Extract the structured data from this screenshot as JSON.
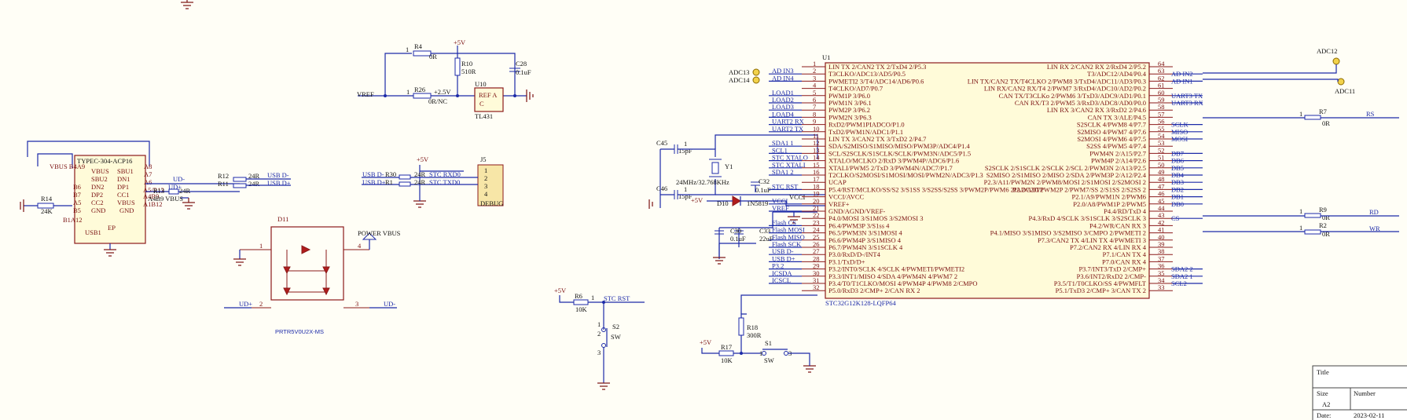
{
  "top_ref": {
    "r4": "R4",
    "r4_val": "0R",
    "r4_pin": "1",
    "vcc": "+5V",
    "r10": "R10",
    "r10_val": "510R",
    "c28": "C28",
    "c28_val": "0.1uF",
    "u10": "U10",
    "u10_ref": "REF A",
    "u10_c": "C",
    "u10_part": "TL431",
    "vref": "VREF",
    "r26": "R26",
    "r26_val": "0R/NC",
    "r26_pin": "1",
    "r26_net": "+2.5V"
  },
  "usb": {
    "part": "TYPEC-304-ACP16",
    "vbus_b4a9": "VBUS B4A9",
    "left_pins": [
      "B6",
      "B7",
      "A5",
      "B5",
      "B1A12"
    ],
    "left_names": [
      "DN2",
      "DP2",
      "CC2",
      "GND"
    ],
    "right_names": [
      "SBU1",
      "DN1",
      "DP1",
      "CC1",
      "VBUS",
      "GND"
    ],
    "right_pins": [
      "A8",
      "A7",
      "A6",
      "A4B9",
      "A1B12"
    ],
    "vbus_left": "VBUS",
    "sbu2": "SBU2",
    "usb1": "USB1",
    "ep": "EP",
    "r14": "R14",
    "r14_val": "24K",
    "r13": "R13",
    "r13_val": "24R",
    "a5r13": "A5/R13",
    "udm": "UD-",
    "udp": "UD+",
    "r12": "R12",
    "r12_val": "24R",
    "r11": "R11",
    "r11_val": "24R",
    "usbdm": "USB D-",
    "usbdp": "USB D+",
    "a4b9_vbus": "A4B9 VBUS"
  },
  "debug": {
    "vcc": "+5V",
    "j5": "J5",
    "net_dm": "USB D-",
    "net_dp": "USB D+",
    "r30": "R30",
    "r30_val": "24R",
    "r1": "R1",
    "r1_val": "24R",
    "stc_rxd": "STC RXD0",
    "stc_txd": "STC TXD0",
    "pins": [
      "1",
      "2",
      "3",
      "4"
    ],
    "label": "DEBUG"
  },
  "prt": {
    "d11": "D11",
    "power_vbus": "POWER VBUS",
    "pin1": "1",
    "pin2": "2",
    "pin3": "3",
    "pin4": "4",
    "udp": "UD+",
    "udm": "UD-",
    "part": "PRTR5V0U2X-MS"
  },
  "reset": {
    "vcc": "+5V",
    "r6": "R6",
    "r6_val": "10K",
    "r6_pin": "1",
    "net": "STC RST",
    "s2": "S2",
    "sw": "SW",
    "p1": "1",
    "p2": "2",
    "p3": "3"
  },
  "sw1": {
    "vcc": "+5V",
    "r17": "R17",
    "r17_val": "10K",
    "r18": "R18",
    "r18_val": "300R",
    "s1": "S1",
    "sw": "SW",
    "p1": "1",
    "p3": "3"
  },
  "osc": {
    "c45": "C45",
    "c45_val": "15pF",
    "c46": "C46",
    "c46_val": "15pF",
    "y1": "Y1",
    "y1_val": "24MHz/32.768KHz",
    "c32": "C32",
    "c32_val": "0.1uF",
    "d10": "D10",
    "d10_val": "1N5819",
    "vcc": "+5V",
    "vcci": "VCCI",
    "c30": "C30",
    "c30_val": "0.1uF",
    "c33": "C33",
    "c33_val": "22uF",
    "one": "1",
    "one_b": "1"
  },
  "mcu": {
    "ref": "U1",
    "part": "STC32G12K128-LQFP64",
    "left_nets": [
      "",
      "AD IN3",
      "AD IN4",
      "",
      "LOAD1",
      "LOAD2",
      "LOAD3",
      "LOAD4",
      "UART2 RX",
      "UART2 TX",
      "",
      "SDA1 1",
      "SCL1",
      "STC XTALO",
      "STC XTALI",
      "SDA1 2",
      "",
      "STC RST",
      "",
      "VCCI",
      "VREF",
      "",
      "Flash CS",
      "Flash MOSI",
      "Flash MISO",
      "Flash SCK",
      "USB D-",
      "USB D+",
      "P3.2",
      "ICSDA",
      "ICSCL",
      ""
    ],
    "left_nums": [
      "1",
      "2",
      "3",
      "4",
      "5",
      "6",
      "7",
      "8",
      "9",
      "10",
      "11",
      "12",
      "13",
      "14",
      "15",
      "16",
      "17",
      "18",
      "19",
      "20",
      "21",
      "22",
      "23",
      "24",
      "25",
      "26",
      "27",
      "28",
      "29",
      "30",
      "31",
      "32"
    ],
    "left_names": [
      "LIN TX 2/CAN2 TX 2/TxD4 2/P5.3",
      "T3CLKO/ADC13/AD5/P0.5",
      "PWMETI2 3/T4/ADC14/AD6/P0.6",
      "T4CLKO/AD7/P0.7",
      "PWM1P 3/P6.0",
      "PWM1N 3/P6.1",
      "PWM2P 3/P6.2",
      "PWM2N 3/P6.3",
      "RxD2/PWM1PIADCO/P1.0",
      "TxD2/PWM1N/ADC1/P1.1",
      "LIN TX 3/CAN2 TX 3/TxD2 2/P4.7",
      "SDA/S2MISO/S1MISO/MISO/PWM3P/ADC4/P1.4",
      "SCL/S2SCLK/S1SCLK/SCLK/PWM3N/ADC5/P1.5",
      "XTALO/MCLKO 2/RxD 3/PWM4P/ADC6/P1.6",
      "XTALI/PWM5 2/TxD 3/PWM4N/ADC7/P1.7",
      "T2CLKO/S2MOSI/S1MOSI/MOSI/PWM2N/ADC3/P1.3",
      "UCAP",
      "P5.4/RST/MCLKO/SS/S2 3/S1SS 3/S2SS/S2SS 3/PWM2P/PWM6 2IADC2IT2",
      "VCCI/AVCC",
      "VREF+",
      "GND/AGND/VREF-",
      "P4.0/MOSI 3/S1MOS 3/S2MOSI 3",
      "P6.4/PWM3P 3/S1ss 4",
      "P6.5/PWM3N 3/S1MOSI 4",
      "P6.6/PWM4P 3/S1MISO 4",
      "P6.7/PWM4N 3/S1SCLK 4",
      "P3.0/RxD/D-/INT4",
      "P3.1/TxD/D+",
      "P3.2/INT0/SCLK 4/SCLK 4/PWMETI/PWMETI2",
      "P3.3/INT1/MISO 4/SDA 4/PWM4N 4/PWM7 2",
      "P3.4/T0/T1CLKO/MOSI 4/PWM4P 4/PWM8 2/CMPO",
      "P5.0/RxD3 2/CMP+ 2/CAN RX 2"
    ],
    "right_names": [
      "LIN RX 2/CAN2 RX 2/RxD4 2/P5.2",
      "T3/ADC12/AD4/P0.4",
      "LIN TX/CAN2 TX/T4CLKO 2/PWM8 3/TxD4/ADC11/AD3/P0.3",
      "LIN RX/CAN2 RX/T4 2/PWM7 3/RxD4/ADC10/AD2/P0.2",
      "CAN TX/T3CLKo 2/PWM6 3/TxD3/ADC9/AD1/P0.1",
      "CAN RX/T3 2/PWM5 3/RxD3/ADC8/AD0/P0.0",
      "LIN RX 3/CAN2 RX 3/RxD2 2/P4.6",
      "CAN TX 3/ALE/P4.5",
      "S2SCLK 4/PWM8 4/P7.7",
      "S2MISO 4/PWM7 4/P7.6",
      "S2MOSI 4/PWM6 4/P7.5",
      "S2SS 4/PWM5 4/P7.4",
      "PWM4N 2/A15/P2.7",
      "PWM4P 2/A14/P2.6",
      "S2SCLK 2/S1SCLK 2/SCLK 2/SCL 2/PWM3N 2/A13/P2.5",
      "S2MISO 2/S1MISO 2/MISO 2/SDA 2/PWM3P 2/A12/P2.4",
      "P2.3/A11/PWM2N 2/PWM8/MOSI 2/S1MOSI 2/S2MOSI 2",
      "P2.2/A10/PWM2P 2/PWM7/SS 2/S1SS 2/S2SS 2",
      "P2.1/A9/PWM1N 2/PWM6",
      "P2.0/A8/PWM1P 2/PWM5",
      "P4.4/RD/TxD 4",
      "P4.3/RxD 4/SCLK 3/S1SCLK 3/S2SCLK 3",
      "P4.2/WR/CAN RX 3",
      "P4.1/MISO 3/S1MISO 3/S2MISO 3/CMPO 2/PWMETI 2",
      "P7.3/CAN2 TX 4/LIN TX 4/PWMETI 3",
      "P7.2/CAN2 RX 4/LIN RX 4",
      "P7.1/CAN TX 4",
      "P7.0/CAN RX 4",
      "P3.7/INT3/TxD 2/CMP+",
      "P3.6/INT2/RxD2 2/CMP-",
      "P3.5/T1/T0CLKO/SS 4/PWMFLT",
      "P5.1/TxD3 2/CMP+ 3/CAN TX 2"
    ],
    "right_nums": [
      "64",
      "63",
      "62",
      "61",
      "60",
      "59",
      "58",
      "57",
      "56",
      "55",
      "54",
      "53",
      "52",
      "51",
      "50",
      "49",
      "48",
      "47",
      "46",
      "45",
      "44",
      "43",
      "42",
      "41",
      "40",
      "39",
      "38",
      "37",
      "36",
      "35",
      "34",
      "33"
    ],
    "right_nets": [
      "",
      "AD IN2",
      "AD IN1",
      "",
      "UART3 TX",
      "UART3 RX",
      "",
      "",
      "SCLK",
      "MISO",
      "MOSI",
      "",
      "DB7",
      "DB6",
      "DB5",
      "DB4",
      "DB3",
      "DB2",
      "DB1",
      "DB0",
      "",
      "CS",
      "",
      "",
      "",
      "",
      "",
      "",
      "SDA2 2",
      "SDA2 1",
      "SCL2",
      ""
    ],
    "adc13": "ADC13",
    "adc14": "ADC14",
    "adc12": "ADC12",
    "adc11": "ADC11",
    "r7": "R7",
    "r7_val": "0R",
    "r7_pin": "1",
    "rs": "RS",
    "r9": "R9",
    "r9_val": "0R",
    "r9_pin": "1",
    "rd": "RD",
    "r2": "R2",
    "r2_val": "0R",
    "r2_pin": "1",
    "wr": "WR"
  },
  "title_block": {
    "title": "Title",
    "size": "Size",
    "size_val": "A2",
    "number": "Number",
    "date": "Date:",
    "date_val": "2023-02-11"
  },
  "colors": {
    "wire": "#1c2aa8",
    "part": "#8b1a1a",
    "body": "#fffbd9",
    "background": "#fffef6"
  }
}
